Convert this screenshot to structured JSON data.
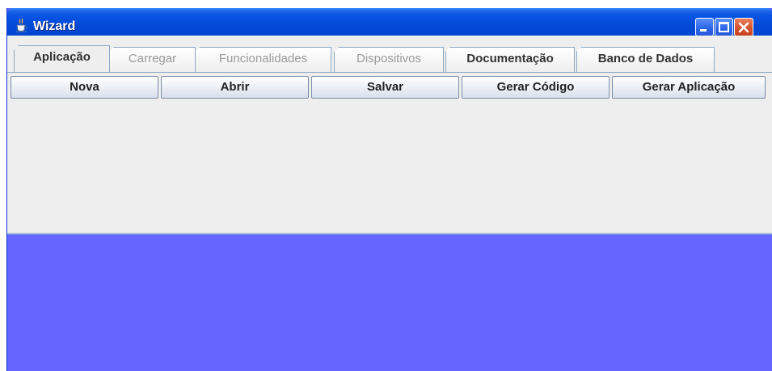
{
  "window": {
    "title": "Wizard",
    "icon": "java-cup-icon",
    "controls": [
      "minimize-icon",
      "maximize-icon",
      "close-icon"
    ]
  },
  "tabs": [
    {
      "label": "Aplicação",
      "state": "selected"
    },
    {
      "label": "Carregar",
      "state": "disabled"
    },
    {
      "label": "Funcionalidades",
      "state": "disabled"
    },
    {
      "label": "Dispositivos",
      "state": "disabled"
    },
    {
      "label": "Documentação",
      "state": "enabled"
    },
    {
      "label": "Banco de Dados",
      "state": "enabled"
    }
  ],
  "toolbar": {
    "nova": "Nova",
    "abrir": "Abrir",
    "salvar": "Salvar",
    "gerar_codigo": "Gerar Código",
    "gerar_aplicacao": "Gerar Aplicação"
  },
  "colors": {
    "background": "#6666ff",
    "panel": "#eeeeee",
    "titlebar": "#0046d0"
  }
}
